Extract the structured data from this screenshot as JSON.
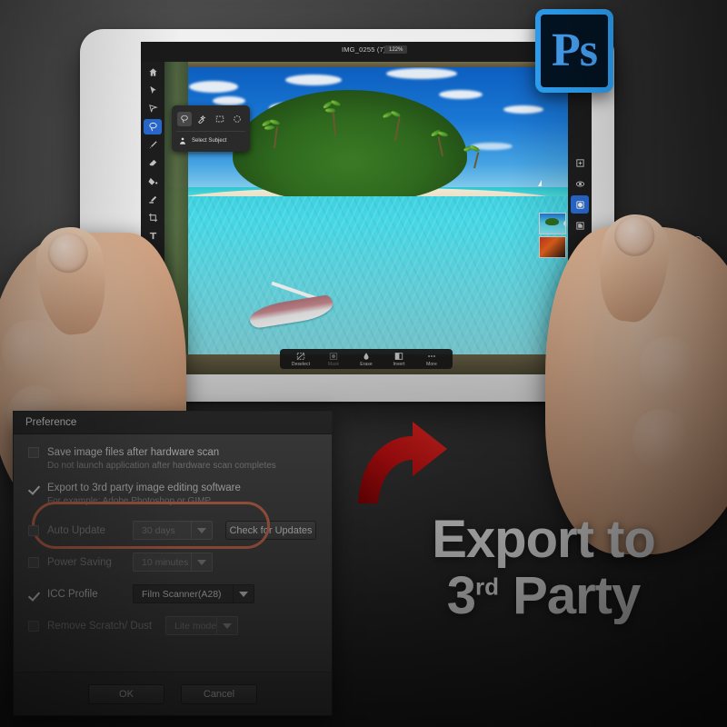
{
  "scene": {
    "headline_line1": "Export to",
    "headline_line2_num": "3",
    "headline_line2_sup": "rd",
    "headline_line2_rest": " Party",
    "arrow_name": "red-curved-arrow",
    "accent_red": "#d40e12",
    "ps_accent": "#2fa8ff"
  },
  "ps_badge": {
    "label": "Ps"
  },
  "photoshop": {
    "document_title": "IMG_0255 (7) *",
    "zoom_level": "122%",
    "home_icon": "home-icon",
    "undo_icon": "undo-icon",
    "redo_icon": "redo-icon",
    "share_icon": "share-icon",
    "left_tools": [
      {
        "name": "move-tool",
        "icon": "cursor-arrow-icon",
        "active": false
      },
      {
        "name": "transform-tool",
        "icon": "transform-icon",
        "active": false
      },
      {
        "name": "selection-tool",
        "icon": "lasso-icon",
        "active": true
      },
      {
        "name": "brush-tool",
        "icon": "brush-icon",
        "active": false
      },
      {
        "name": "eraser-tool",
        "icon": "eraser-icon",
        "active": false
      },
      {
        "name": "fill-tool",
        "icon": "paint-bucket-icon",
        "active": false
      },
      {
        "name": "clone-stamp-tool",
        "icon": "clone-stamp-icon",
        "active": false
      },
      {
        "name": "crop-tool",
        "icon": "crop-icon",
        "active": false
      },
      {
        "name": "type-tool",
        "icon": "text-t-icon",
        "active": false
      },
      {
        "name": "place-image-tool",
        "icon": "image-icon",
        "active": false
      },
      {
        "name": "eyedropper-tool",
        "icon": "eyedropper-icon",
        "active": false
      }
    ],
    "right_tools": [
      {
        "name": "adjustments",
        "icon": "sliders-icon",
        "active": false
      },
      {
        "name": "add-layer",
        "icon": "plus-square-icon",
        "active": false
      },
      {
        "name": "layer-visibility",
        "icon": "eye-icon",
        "active": false
      },
      {
        "name": "layer-mask",
        "icon": "mask-circle-icon",
        "active": true
      },
      {
        "name": "clipping-mask",
        "icon": "clip-layer-icon",
        "active": false
      },
      {
        "name": "blend-mode",
        "icon": "blend-icon",
        "active": false
      },
      {
        "name": "more-options",
        "icon": "ellipsis-icon",
        "active": false
      }
    ],
    "select_popup": {
      "tools": [
        {
          "name": "lasso-select",
          "icon": "lasso-icon",
          "active": true
        },
        {
          "name": "quick-select",
          "icon": "quick-select-icon",
          "active": false
        },
        {
          "name": "rectangle-marquee",
          "icon": "rect-marquee-icon",
          "active": false
        },
        {
          "name": "ellipse-marquee",
          "icon": "ellipse-marquee-icon",
          "active": false
        }
      ],
      "subject_label": "Select Subject",
      "subject_icon": "person-subject-icon"
    },
    "bottom_bar": [
      {
        "name": "deselect-action",
        "label": "Deselect",
        "icon": "deselect-icon",
        "dim": false
      },
      {
        "name": "mask-action",
        "label": "Mask",
        "icon": "mask-icon",
        "dim": true
      },
      {
        "name": "erase-action",
        "label": "Erase",
        "icon": "erase-drop-icon",
        "dim": false
      },
      {
        "name": "invert-action",
        "label": "Invert",
        "icon": "invert-icon",
        "dim": false
      },
      {
        "name": "more-action",
        "label": "More",
        "icon": "ellipsis-icon",
        "dim": false
      }
    ],
    "layers": [
      {
        "name": "layer-thumb-island",
        "kind": "t1"
      },
      {
        "name": "layer-thumb-flower",
        "kind": "t2"
      }
    ]
  },
  "dialog": {
    "title": "Preference",
    "options": [
      {
        "name": "save-image-files",
        "label": "Save image files after hardware scan",
        "sub": "Do not launch application after hardware scan completes",
        "checked": false
      },
      {
        "name": "export-3rd-party",
        "label": "Export to 3rd party image editing software",
        "sub": "For example: Adobe Photoshop or GIMP",
        "checked": true
      }
    ],
    "auto_update": {
      "label": "Auto Update",
      "checked": false,
      "value": "30 days",
      "button_label": "Check for Updates"
    },
    "power_saving": {
      "label": "Power Saving",
      "checked": false,
      "value": "10 minutes"
    },
    "icc_profile": {
      "label": "ICC Profile",
      "checked": true,
      "value": "Film Scanner(A28)"
    },
    "remove_scratch": {
      "label": "Remove Scratch/ Dust",
      "checked": false,
      "value": "Lite mode"
    },
    "ok_label": "OK",
    "cancel_label": "Cancel",
    "highlight_color": "#e2795a"
  }
}
